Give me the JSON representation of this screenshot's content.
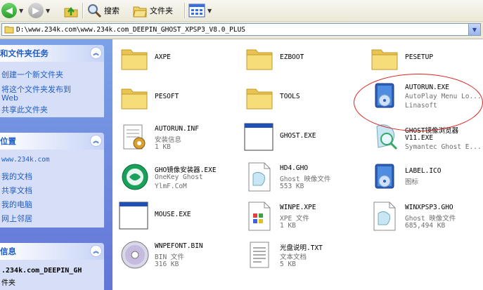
{
  "toolbar": {
    "back_label": "",
    "search_label": "搜索",
    "folders_label": "文件夹"
  },
  "address": {
    "path": "D:\\www.234k.com\\www.234k.com_DEEPIN_GHOST_XPSP3_V8.0_PLUS"
  },
  "tasks": {
    "title": "和文件夹任务",
    "items": [
      "创建一个新文件夹",
      "将这个文件夹发布到",
      "Web",
      "共享此文件夹"
    ]
  },
  "places": {
    "title": "位置",
    "items": [
      "www.234k.com",
      "我的文档",
      "共享文档",
      "我的电脑",
      "网上邻居"
    ]
  },
  "details": {
    "title": "信息",
    "line1": ".234k.com_DEEPIN_GH",
    "line2": "件夹"
  },
  "files": [
    {
      "name": "AXPE",
      "l2": "",
      "l3": "",
      "icon": "folder-icon"
    },
    {
      "name": "EZBOOT",
      "l2": "",
      "l3": "",
      "icon": "folder-icon"
    },
    {
      "name": "PESETUP",
      "l2": "",
      "l3": "",
      "icon": "folder-icon"
    },
    {
      "name": "PESOFT",
      "l2": "",
      "l3": "",
      "icon": "folder-icon"
    },
    {
      "name": "TOOLS",
      "l2": "",
      "l3": "",
      "icon": "folder-icon"
    },
    {
      "name": "AUTORUN.EXE",
      "l2": "AutoPlay Menu Lo...",
      "l3": "Linasoft",
      "icon": "autoplay-icon"
    },
    {
      "name": "AUTORUN.INF",
      "l2": "安装信息",
      "l3": "1 KB",
      "icon": "setup-info-icon"
    },
    {
      "name": "GHOST.EXE",
      "l2": "",
      "l3": "",
      "icon": "app-window-icon"
    },
    {
      "name": "GHOST镜像浏览器",
      "l2": "V11.EXE",
      "l3": "Symantec Ghost E...",
      "icon": "ghost-explorer-icon"
    },
    {
      "name": "GHO镜像安装器.EXE",
      "l2": "OneKey Ghost",
      "l3": "YlmF.CoM",
      "icon": "onekey-ghost-icon"
    },
    {
      "name": "HD4.GHO",
      "l2": "Ghost 映像文件",
      "l3": "553 KB",
      "icon": "ghost-image-file-icon"
    },
    {
      "name": "LABEL.ICO",
      "l2": "图标",
      "l3": "",
      "icon": "label-icon"
    },
    {
      "name": "MOUSE.EXE",
      "l2": "",
      "l3": "",
      "icon": "app-window-icon"
    },
    {
      "name": "WINPE.XPE",
      "l2": "XPE 文件",
      "l3": "1 KB",
      "icon": "xpe-file-icon"
    },
    {
      "name": "WINXPSP3.GHO",
      "l2": "Ghost 映像文件",
      "l3": "685,494 KB",
      "icon": "ghost-image-file-icon"
    },
    {
      "name": "WNPEFONT.BIN",
      "l2": "BIN 文件",
      "l3": "316 KB",
      "icon": "disc-icon"
    },
    {
      "name": "光盘说明.TXT",
      "l2": "文本文档",
      "l3": "5 KB",
      "icon": "text-document-icon"
    }
  ]
}
